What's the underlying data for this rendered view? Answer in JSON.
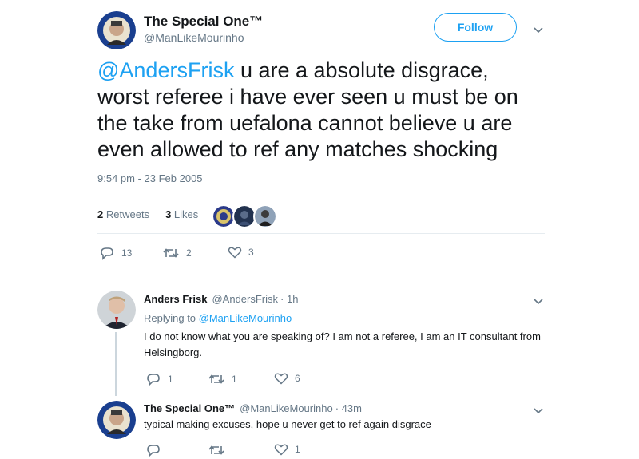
{
  "main_tweet": {
    "display_name": "The Special One™",
    "handle": "@ManLikeMourinho",
    "follow_label": "Follow",
    "mention": "@AndersFrisk",
    "text_rest": " u are a absolute disgrace, worst referee i have ever seen u must be on the take from uefalona cannot believe u are even allowed to ref any matches shocking",
    "timestamp": "9:54 pm - 23 Feb 2005",
    "retweets_count": "2",
    "retweets_label": "Retweets",
    "likes_count": "3",
    "likes_label": "Likes",
    "reply_count": "13",
    "retweet_count_action": "2",
    "like_count_action": "3"
  },
  "replies": [
    {
      "display_name": "Anders Frisk",
      "handle": "@AndersFrisk",
      "time": "· 1h",
      "replying_prefix": "Replying to ",
      "replying_to": "@ManLikeMourinho",
      "text": "I do not know what you are speaking of? I am not a referee, I am an IT consultant from Helsingborg.",
      "reply_count": "1",
      "retweet_count": "1",
      "like_count": "6"
    },
    {
      "display_name": "The Special One™",
      "handle": "@ManLikeMourinho",
      "time": "· 43m",
      "text": "typical making excuses, hope u never get to ref again disgrace",
      "reply_count": "",
      "retweet_count": "",
      "like_count": "1"
    }
  ],
  "avatar_badge_text": "CHELSEA",
  "colors": {
    "accent": "#1da1f2",
    "muted": "#657786",
    "text": "#14171a",
    "divider": "#e6ecf0"
  },
  "icons": [
    "reply-icon",
    "retweet-icon",
    "like-icon",
    "chevron-down-icon"
  ]
}
